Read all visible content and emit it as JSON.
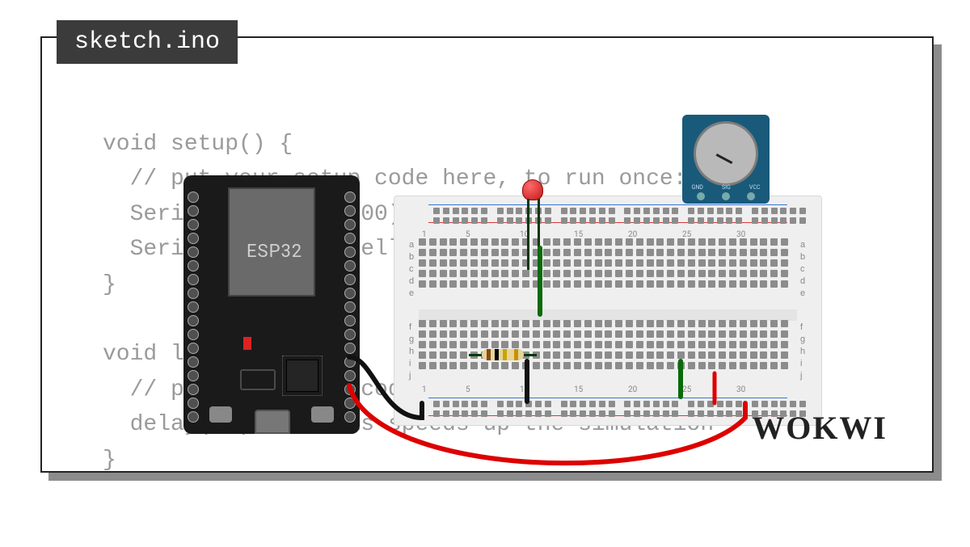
{
  "tab_title": "sketch.ino",
  "logo_text": "WOKWI",
  "code_lines": "void setup() {\n  // put your setup code here, to run once:\n  Serial.begin(115200);\n  Serial.println(\"Hello, ESP32!\");\n}\n\nvoid loop() {\n  // put your main code here, to run repeatedly:\n  delay(10); // this speeds up the simulation\n}",
  "components": {
    "mcu": {
      "name": "ESP32",
      "label": "ESP32"
    },
    "breadboard": {
      "columns": [
        "1",
        "5",
        "10",
        "15",
        "20",
        "25",
        "30"
      ],
      "rows_top": [
        "a",
        "b",
        "c",
        "d",
        "e"
      ],
      "rows_bottom": [
        "f",
        "g",
        "h",
        "i",
        "j"
      ]
    },
    "potentiometer": {
      "pins": [
        "GND",
        "SIG",
        "VCC"
      ]
    },
    "led": {
      "color": "#c41717"
    },
    "resistor": {
      "bands": [
        "#8a4a16",
        "#000",
        "#c8a400",
        "#c89200"
      ]
    }
  },
  "wires": [
    {
      "name": "gnd-black-short",
      "color": "#111",
      "from": "esp32-gnd",
      "to": "breadboard-rail"
    },
    {
      "name": "vcc-red",
      "color": "#d00",
      "from": "esp32-3v3",
      "to": "breadboard-rail-plus"
    },
    {
      "name": "led-anode-green",
      "color": "#0a6a0a",
      "from": "breadboard-top",
      "to": "breadboard-bottom"
    },
    {
      "name": "led-cathode-black",
      "color": "#111",
      "from": "breadboard",
      "to": "gnd-rail"
    },
    {
      "name": "pot-sig-green",
      "color": "#0a6a0a",
      "from": "pot",
      "to": "breadboard"
    },
    {
      "name": "pot-vcc-red",
      "color": "#d00",
      "from": "pot",
      "to": "breadboard"
    }
  ]
}
